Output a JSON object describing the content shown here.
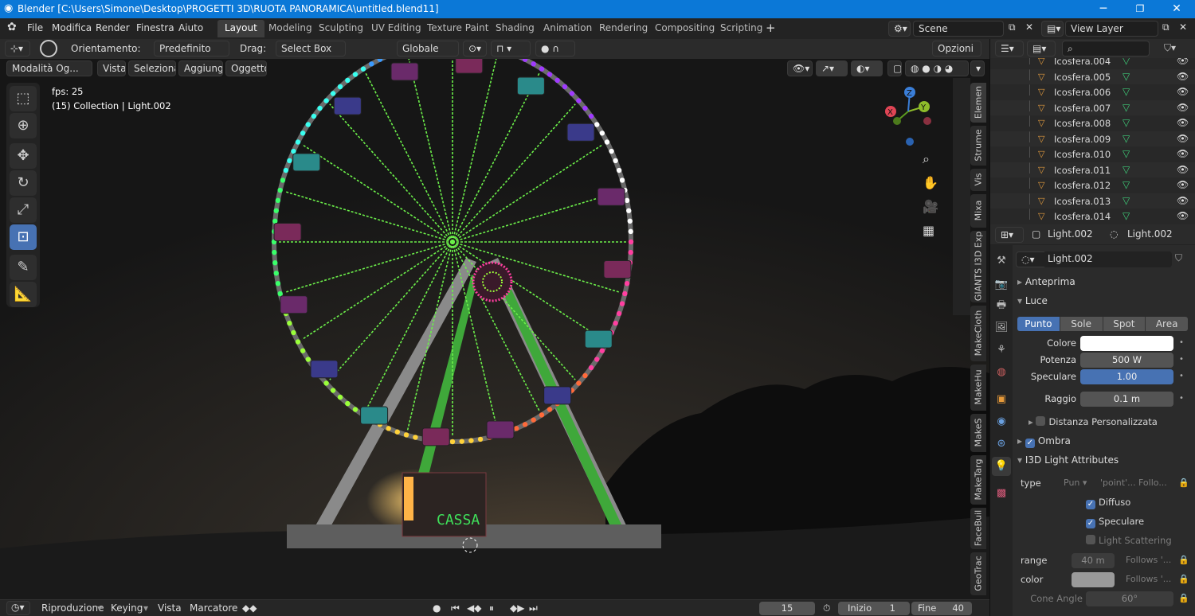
{
  "window": {
    "title": "Blender [C:\\Users\\Simone\\Desktop\\PROGETTI 3D\\RUOTA PANORAMICA\\untitled.blend11]",
    "min": "─",
    "max": "❐",
    "close": "✕"
  },
  "menu": [
    "File",
    "Modifica",
    "Render",
    "Finestra",
    "Aiuto"
  ],
  "workspaces": [
    "Layout",
    "Modeling",
    "Sculpting",
    "UV Editing",
    "Texture Paint",
    "Shading",
    "Animation",
    "Rendering",
    "Compositing",
    "Scripting"
  ],
  "workspace_add": "+",
  "scene": {
    "name": "Scene",
    "view_layer": "View Layer"
  },
  "toolbar": {
    "orient_label": "Orientamento:",
    "orient_value": "Predefinito",
    "drag_label": "Drag:",
    "drag_value": "Select Box",
    "transform": "Globale",
    "options": "Opzioni"
  },
  "header2": {
    "mode": "Modalità Og...",
    "items": [
      "Vista",
      "Seleziona",
      "Aggiungi",
      "Oggetto"
    ]
  },
  "overlay": {
    "fps": "fps: 25",
    "info": "(15) Collection | Light.002"
  },
  "gizmo": {
    "x": "X",
    "y": "Y",
    "z": "Z"
  },
  "sign": "CASSA",
  "side_tabs": [
    "Elemen",
    "Strume",
    "Vis",
    "Mixa",
    "GIANTS I3D Exp",
    "MakeCloth",
    "MakeHu",
    "MakeS",
    "MakeTarg",
    "FaceBuil",
    "GeoTrac"
  ],
  "outliner": {
    "items": [
      "Icosfera.004",
      "Icosfera.005",
      "Icosfera.006",
      "Icosfera.007",
      "Icosfera.008",
      "Icosfera.009",
      "Icosfera.010",
      "Icosfera.011",
      "Icosfera.012",
      "Icosfera.013",
      "Icosfera.014"
    ]
  },
  "props": {
    "header_obj": "Light.002",
    "header_data": "Light.002",
    "datablock": "Light.002",
    "sec_preview": "Anteprima",
    "sec_light": "Luce",
    "light_types": [
      "Punto",
      "Sole",
      "Spot",
      "Area"
    ],
    "color_label": "Colore",
    "color_value": "#ffffff",
    "power_label": "Potenza",
    "power_value": "500 W",
    "specular_label": "Speculare",
    "specular_value": "1.00",
    "radius_label": "Raggio",
    "radius_value": "0.1 m",
    "custom_distance": "Distanza Personalizzata",
    "shadow": "Ombra",
    "i3d": "I3D Light Attributes",
    "type_label": "type",
    "type_values": [
      "Pun",
      "'point'...",
      "Follo..."
    ],
    "diffuse": "Diffuso",
    "specular_chk": "Speculare",
    "scattering": "Light Scattering",
    "range_label": "range",
    "range_value": "40 m",
    "range_follow": "Follows '...",
    "color2_label": "color",
    "color2_follow": "Follows '...",
    "cone_label": "Cone Angle",
    "cone_value": "60°"
  },
  "timeline": {
    "menu": [
      "Riproduzione",
      "Keying",
      "Vista",
      "Marcatore"
    ],
    "frame": "15",
    "start_label": "Inizio",
    "start": "1",
    "end_label": "Fine",
    "end": "40"
  }
}
